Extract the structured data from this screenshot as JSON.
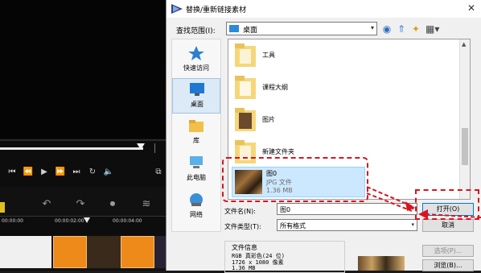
{
  "editor": {
    "ruler_times": [
      "00:00:00",
      "00:00:02:00",
      "00:00:04:00"
    ]
  },
  "dialog": {
    "title": "替换/重新链接素材",
    "lookin_label": "查找范围(I):",
    "lookin_value": "桌面",
    "places": [
      {
        "label": "快速访问",
        "icon": "star-icon"
      },
      {
        "label": "桌面",
        "icon": "desktop-icon"
      },
      {
        "label": "库",
        "icon": "library-icon"
      },
      {
        "label": "此电脑",
        "icon": "computer-icon"
      },
      {
        "label": "网络",
        "icon": "network-icon"
      }
    ],
    "files": [
      {
        "name": "工具",
        "icon": "folder-icon"
      },
      {
        "name": "课程大纲",
        "icon": "folder-icon"
      },
      {
        "name": "图片",
        "icon": "folder-icon"
      },
      {
        "name": "新建文件夹",
        "icon": "folder-icon"
      }
    ],
    "selected": {
      "name": "图0",
      "type": "JPG 文件",
      "size": "1.36 MB"
    },
    "filename_label": "文件名(N):",
    "filename_value": "图0",
    "filetype_label": "文件类型(T):",
    "filetype_value": "所有格式",
    "open_label": "打开(O)",
    "cancel_label": "取消",
    "options_label": "选项(P)...",
    "browse_label": "浏览(B)...",
    "info": {
      "title": "文件信息",
      "line1": "RGB 真彩色(24 位)",
      "line2": "1726 x 1080 像素",
      "line3": "1.36 MB"
    }
  },
  "colors": {
    "annotation_red": "#d9141e",
    "selection_blue": "#cce8ff",
    "folder_yellow": "#f5d77a"
  }
}
